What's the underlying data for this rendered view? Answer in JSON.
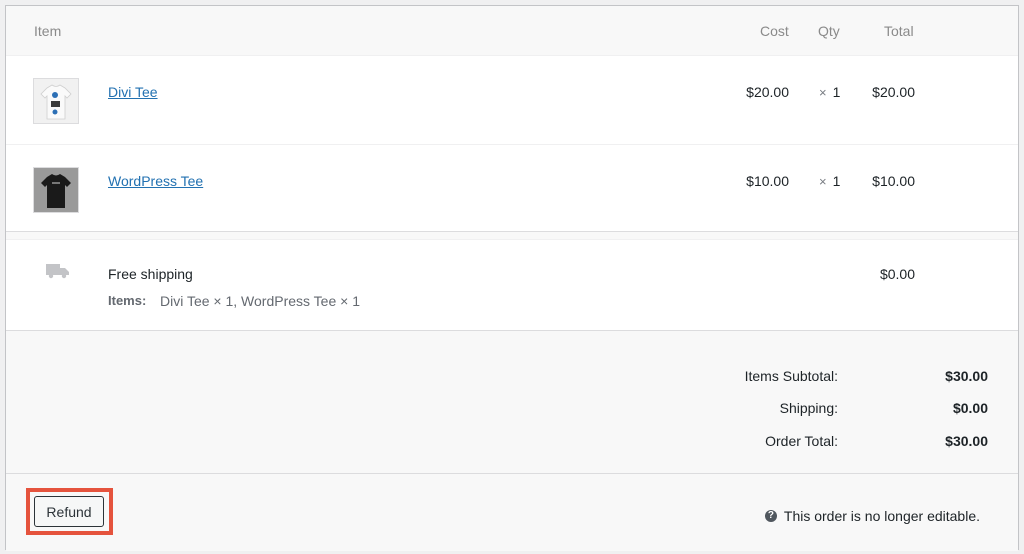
{
  "columns": {
    "item": "Item",
    "cost": "Cost",
    "qty": "Qty",
    "total": "Total"
  },
  "items": [
    {
      "name": "Divi Tee",
      "cost": "$20.00",
      "qty_symbol": "×",
      "qty": "1",
      "total": "$20.00",
      "thumb_color": "#f2f2f2"
    },
    {
      "name": "WordPress Tee",
      "cost": "$10.00",
      "qty_symbol": "×",
      "qty": "1",
      "total": "$10.00",
      "thumb_color": "#1a1a1a"
    }
  ],
  "shipping": {
    "method": "Free shipping",
    "items_label": "Items:",
    "items_value": "Divi Tee × 1, WordPress Tee × 1",
    "total": "$0.00"
  },
  "totals": {
    "subtotal_label": "Items Subtotal:",
    "subtotal_value": "$30.00",
    "shipping_label": "Shipping:",
    "shipping_value": "$0.00",
    "order_total_label": "Order Total:",
    "order_total_value": "$30.00"
  },
  "actions": {
    "refund_label": "Refund",
    "help_icon": "?",
    "not_editable_text": "This order is no longer editable."
  },
  "colors": {
    "link": "#2271b1",
    "highlight": "#e5533d",
    "panel_bg": "#f8f8f8"
  }
}
